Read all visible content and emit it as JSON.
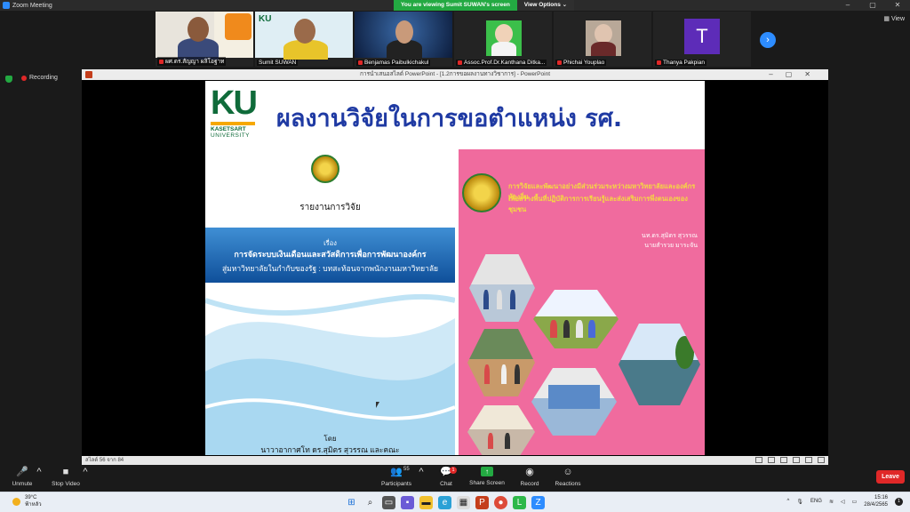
{
  "window": {
    "title": "Zoom Meeting"
  },
  "banner": {
    "viewing": "You are viewing Sumit SUWAN's screen",
    "view_options": "View Options"
  },
  "strip": {
    "view_label": "View",
    "participants": [
      {
        "name": "ผศ.ดร.สัญญา ผลิโอฐาท",
        "muted": true
      },
      {
        "name": "Sumit SUWAN",
        "muted": false
      },
      {
        "name": "Benjamas Paibulkichakul",
        "muted": true
      },
      {
        "name": "Assoc.Prof.Dr.Kanthana Ditka...",
        "muted": true
      },
      {
        "name": "Phichai Youplao",
        "muted": true
      },
      {
        "name": "Thanya Pakpian",
        "muted": true
      }
    ],
    "avatar_letter": "T"
  },
  "recording": {
    "label": "Recording"
  },
  "ppt": {
    "window_title": "การนำเสนอสไลด์ PowerPoint - [1.2การขอผลงานทางวิชาการ] - PowerPoint",
    "status": "สไลด์ 56 จาก 84"
  },
  "slide": {
    "logo": {
      "ku": "KU",
      "name": "KASETSART",
      "uni": "UNIVERSITY"
    },
    "title": "ผลงานวิจัยในการขอตำแหน่ง รศ.",
    "cover1": {
      "report": "รายงานการวิจัย",
      "subject": "เรื่อง",
      "line1": "การจัดระบบเงินเดือนและสวัสดิการเพื่อการพัฒนาองค์กร",
      "line2": "สู่มหาวิทยาลัยในกำกับของรัฐ : บทสะท้อนจากพนักงานมหาวิทยาลัย",
      "by": "โดย",
      "author": "นาวาอากาศโท ดร.สุมิตร สุวรรณ และคณะ"
    },
    "cover2": {
      "title1": "การวิจัยและพัฒนาอย่างมีส่วนร่วมระหว่างมหาวิทยาลัยและองค์กรท้องถิ่น",
      "title2": "เพื่อสร้างพื้นที่ปฏิบัติการการเรียนรู้และส่งเสริมการพึ่งตนเองของชุมชน",
      "author1": "นท.ดร.สุมิตร สุวรรณ",
      "author2": "นายสำรวย มาระจัน"
    }
  },
  "controls": {
    "unmute": "Unmute",
    "stop_video": "Stop Video",
    "participants": "Participants",
    "participants_count": "55",
    "chat": "Chat",
    "chat_badge": "1",
    "share": "Share Screen",
    "record": "Record",
    "reactions": "Reactions",
    "leave": "Leave"
  },
  "taskbar": {
    "temp": "39°C",
    "weather": "ฟ้าหลัว",
    "lang": "ENG",
    "time": "15:16",
    "date": "28/4/2565",
    "notif": "1"
  }
}
